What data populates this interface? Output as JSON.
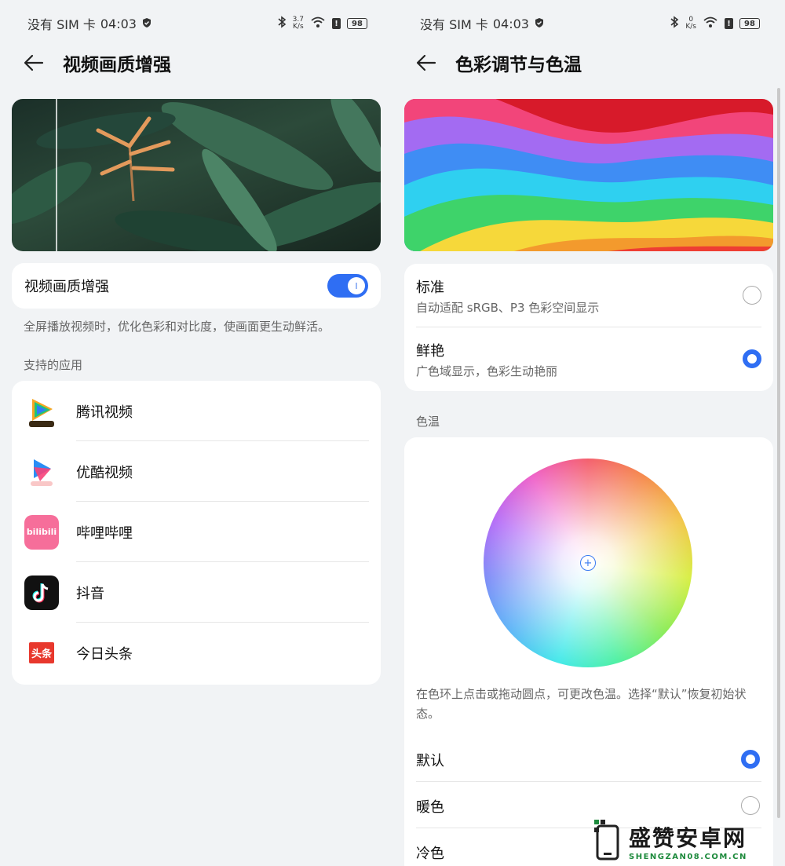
{
  "colors": {
    "accent": "#2f6ef3",
    "background": "#f1f3f5",
    "card": "#ffffff",
    "secondary_text": "#666666"
  },
  "left_screen": {
    "status": {
      "carrier": "没有 SIM 卡",
      "time": "04:03",
      "speed_value": "3.7",
      "speed_unit": "K/s",
      "battery": "98"
    },
    "title": "视频画质增强",
    "toggle": {
      "label": "视频画质增强",
      "on": true
    },
    "description": "全屏播放视频时，优化色彩和对比度，使画面更生动鲜活。",
    "section_label": "支持的应用",
    "apps": [
      {
        "name": "腾讯视频",
        "icon": "tencent-video-icon"
      },
      {
        "name": "优酷视频",
        "icon": "youku-icon"
      },
      {
        "name": "哔哩哔哩",
        "icon": "bilibili-icon"
      },
      {
        "name": "抖音",
        "icon": "douyin-icon"
      },
      {
        "name": "今日头条",
        "icon": "toutiao-icon"
      }
    ],
    "icon_texts": {
      "bilibili": "bilibili",
      "toutiao": "头条"
    }
  },
  "right_screen": {
    "status": {
      "carrier": "没有 SIM 卡",
      "time": "04:03",
      "speed_value": "0",
      "speed_unit": "K/s",
      "battery": "98"
    },
    "title": "色彩调节与色温",
    "modes": [
      {
        "title": "标准",
        "subtitle": "自动适配 sRGB、P3 色彩空间显示",
        "selected": false
      },
      {
        "title": "鲜艳",
        "subtitle": "广色域显示，色彩生动艳丽",
        "selected": true
      }
    ],
    "temp_section_label": "色温",
    "temp_description": "在色环上点击或拖动圆点，可更改色温。选择“默认”恢复初始状态。",
    "temp_options": [
      {
        "label": "默认",
        "selected": true
      },
      {
        "label": "暖色",
        "selected": false
      },
      {
        "label": "冷色",
        "selected": false
      }
    ]
  },
  "watermark": {
    "title": "盛赞安卓网",
    "subtitle": "SHENGZAN08.COM.CN"
  }
}
